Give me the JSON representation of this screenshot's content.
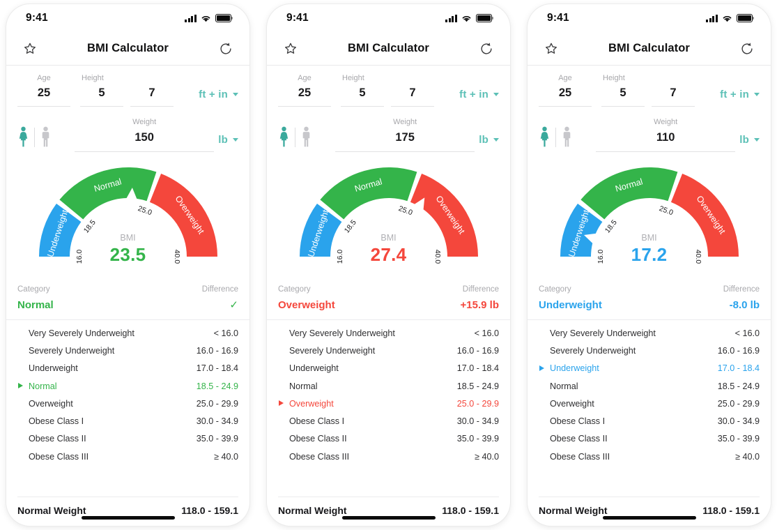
{
  "colors": {
    "teal": "#5cc0b6",
    "green": "#34b44a",
    "blue": "#2aa3ec",
    "red": "#f4473c",
    "gray_label": "#a7a7ab",
    "text": "#2e2e30"
  },
  "status_bar": {
    "time": "9:41",
    "signal_icon": "cellular-signal-icon",
    "wifi_icon": "wifi-icon",
    "battery_icon": "battery-icon"
  },
  "nav": {
    "title": "BMI Calculator",
    "left_icon": "star-outline-icon",
    "right_icon": "refresh-icon"
  },
  "labels": {
    "age": "Age",
    "height": "Height",
    "weight": "Weight",
    "bmi_caption": "BMI",
    "category_header": "Category",
    "difference_header": "Difference",
    "normal_weight": "Normal Weight",
    "female_icon": "female-gender-icon",
    "male_icon": "male-gender-icon"
  },
  "gauge": {
    "ticks": [
      "16.0",
      "18.5",
      "25.0",
      "40.0"
    ],
    "segments": [
      {
        "label": "Underweight",
        "from": 16.0,
        "to": 18.5,
        "color": "#2aa3ec"
      },
      {
        "label": "Normal",
        "from": 18.5,
        "to": 25.0,
        "color": "#34b44a"
      },
      {
        "label": "Overweight",
        "from": 25.0,
        "to": 40.0,
        "color": "#f4473c"
      }
    ],
    "min": 16.0,
    "max": 40.0
  },
  "table_rows": [
    {
      "name": "Very Severely Underweight",
      "range": "< 16.0"
    },
    {
      "name": "Severely Underweight",
      "range": "16.0 - 16.9"
    },
    {
      "name": "Underweight",
      "range": "17.0 - 18.4"
    },
    {
      "name": "Normal",
      "range": "18.5 - 24.9"
    },
    {
      "name": "Overweight",
      "range": "25.0 - 29.9"
    },
    {
      "name": "Obese Class I",
      "range": "30.0 - 34.9"
    },
    {
      "name": "Obese Class II",
      "range": "35.0 - 39.9"
    },
    {
      "name": "Obese Class III",
      "range": "≥ 40.0"
    }
  ],
  "normal_weight_range": "118.0 - 159.1",
  "panels": [
    {
      "age": "25",
      "height_ft": "5",
      "height_in": "7",
      "height_unit": "ft + in",
      "weight": "150",
      "weight_unit": "lb",
      "bmi": "23.5",
      "bmi_value": 23.5,
      "category": "Normal",
      "difference": "✓",
      "difference_is_check": true,
      "accent": "#34b44a",
      "active_row": 3
    },
    {
      "age": "25",
      "height_ft": "5",
      "height_in": "7",
      "height_unit": "ft + in",
      "weight": "175",
      "weight_unit": "lb",
      "bmi": "27.4",
      "bmi_value": 27.4,
      "category": "Overweight",
      "difference": "+15.9 lb",
      "difference_is_check": false,
      "accent": "#f4473c",
      "active_row": 4
    },
    {
      "age": "25",
      "height_ft": "5",
      "height_in": "7",
      "height_unit": "ft + in",
      "weight": "110",
      "weight_unit": "lb",
      "bmi": "17.2",
      "bmi_value": 17.2,
      "category": "Underweight",
      "difference": "-8.0 lb",
      "difference_is_check": false,
      "accent": "#2aa3ec",
      "active_row": 2
    }
  ]
}
